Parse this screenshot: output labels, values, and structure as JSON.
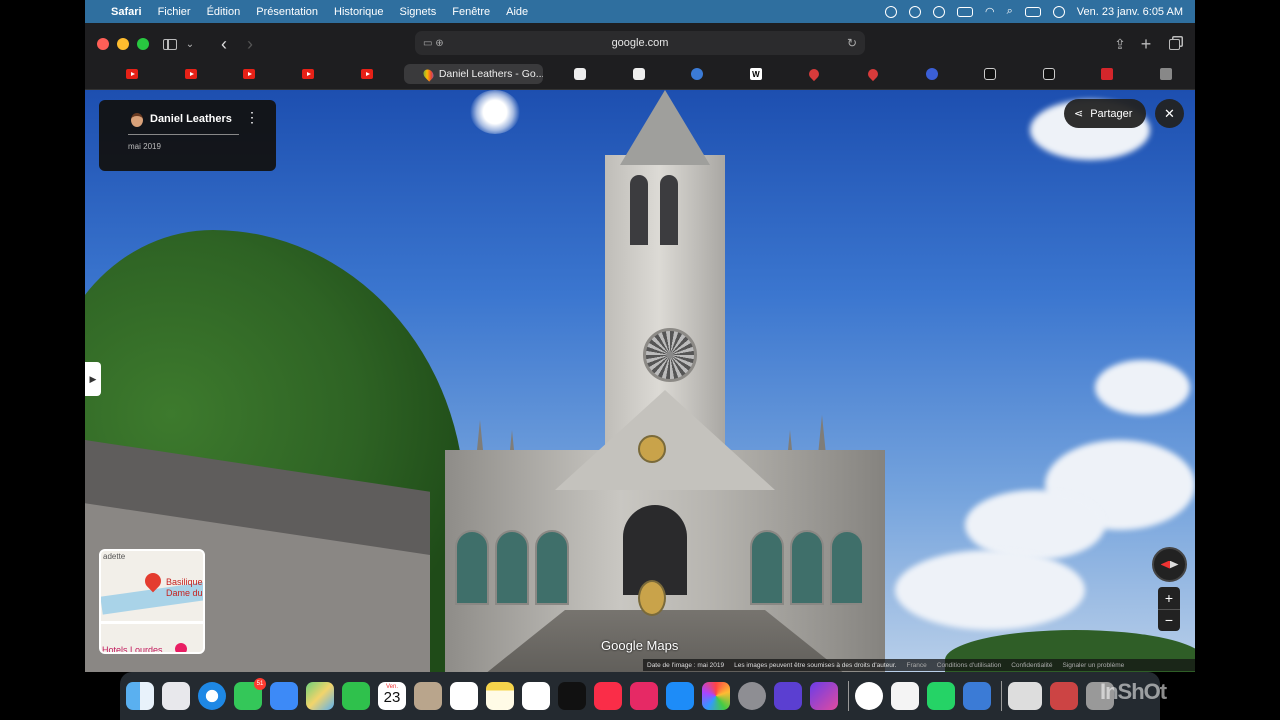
{
  "menubar": {
    "items": [
      "Safari",
      "Fichier",
      "Édition",
      "Présentation",
      "Historique",
      "Signets",
      "Fenêtre",
      "Aide"
    ],
    "datetime": "Ven. 23 janv.  6:05 AM"
  },
  "browser": {
    "url": "google.com",
    "active_tab_title": "Daniel Leathers - Go..."
  },
  "streetview": {
    "author_name": "Daniel Leathers",
    "author_date": "mai 2019",
    "share_label": "Partager",
    "close_symbol": "✕",
    "more_symbol": "⋮",
    "minimap": {
      "top_label": "adette",
      "place_name": "Basilique",
      "place_name_2": "Dame du",
      "hotel_label": "Hotels Lourdes"
    },
    "zoom_in": "+",
    "zoom_out": "−",
    "logo_text": "Google Maps",
    "attribution": {
      "date": "Date de l'image : mai 2019",
      "rights": "Les images peuvent être soumises à des droits d'auteur.",
      "country": "France",
      "terms": "Conditions d'utilisation",
      "privacy": "Confidentialité",
      "report": "Signaler un problème"
    }
  },
  "dock": {
    "messages_badge": "51",
    "calendar_month": "Ven.",
    "calendar_day": "23"
  },
  "watermark": "InShOt",
  "colors": {
    "menubar_bg": "#2f6f9f",
    "chrome_bg": "#1e1e20",
    "sky_top": "#1d4fb0"
  }
}
